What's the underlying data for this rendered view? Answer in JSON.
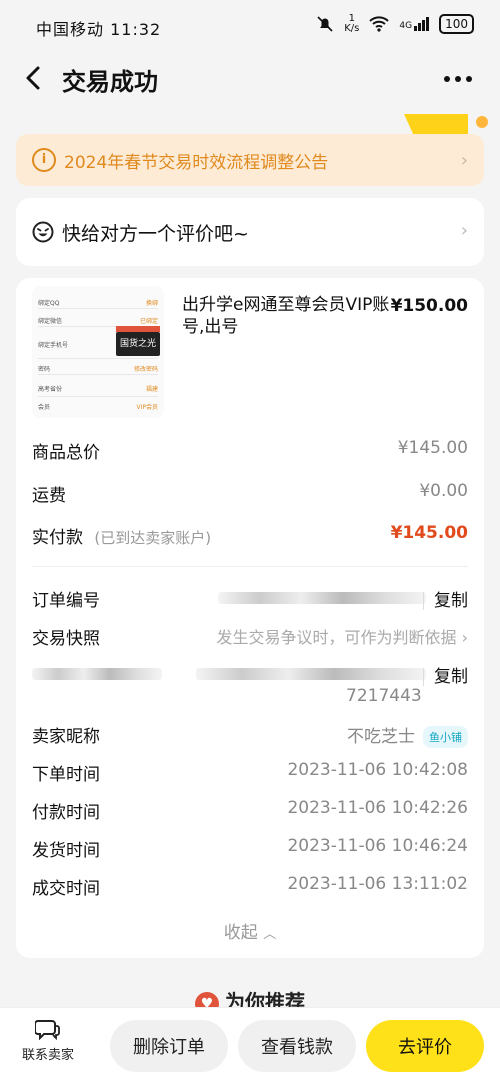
{
  "status_bar": {
    "carrier": "中国移动 11:32",
    "net_speed_value": "1",
    "net_speed_unit": "K/s",
    "network_type": "4G",
    "battery": "100"
  },
  "header": {
    "title": "交易成功"
  },
  "notice": {
    "text": "2024年春节交易时效流程调整公告"
  },
  "rating_prompt": {
    "text": "快给对方一个评价吧~"
  },
  "product": {
    "title": "出升学e网通至尊会员VIP账号,出号",
    "price": "¥150.00",
    "thumbnail": {
      "badge_text": "国货之光",
      "rows": [
        {
          "label": "绑定QQ",
          "value": "换绑"
        },
        {
          "label": "绑定微信",
          "value": "已绑定"
        },
        {
          "label": "绑定手机号",
          "value": "换绑"
        },
        {
          "label": "密码",
          "value": "修改密码"
        },
        {
          "label": "高考省份",
          "value": "福建"
        },
        {
          "label": "会员",
          "value": "VIP会员"
        }
      ]
    }
  },
  "totals": {
    "goods_total_label": "商品总价",
    "goods_total_value": "¥145.00",
    "shipping_label": "运费",
    "shipping_value": "¥0.00",
    "paid_label": "实付款",
    "paid_note": "(已到达卖家账户)",
    "paid_value": "¥145.00"
  },
  "order": {
    "order_no_label": "订单编号",
    "copy_label": "复制",
    "snapshot_label": "交易快照",
    "snapshot_value": "发生交易争议时，可作为判断依据",
    "hidden_suffix": "7217443",
    "seller_label": "卖家昵称",
    "seller_name": "不吃芝士",
    "shop_badge": "鱼小铺",
    "times": [
      {
        "label": "下单时间",
        "value": "2023-11-06 10:42:08"
      },
      {
        "label": "付款时间",
        "value": "2023-11-06 10:42:26"
      },
      {
        "label": "发货时间",
        "value": "2023-11-06 10:46:24"
      },
      {
        "label": "成交时间",
        "value": "2023-11-06 13:11:02"
      }
    ],
    "collapse_label": "收起"
  },
  "recommend": {
    "title": "为你推荐"
  },
  "bottom_bar": {
    "contact_label": "联系卖家",
    "delete_label": "删除订单",
    "view_money_label": "查看钱款",
    "rate_label": "去评价"
  },
  "colors": {
    "accent_orange": "#e08a1e",
    "price_red": "#e04a1c",
    "primary_yellow": "#ffe11a",
    "shop_badge": "#17a7c4"
  }
}
